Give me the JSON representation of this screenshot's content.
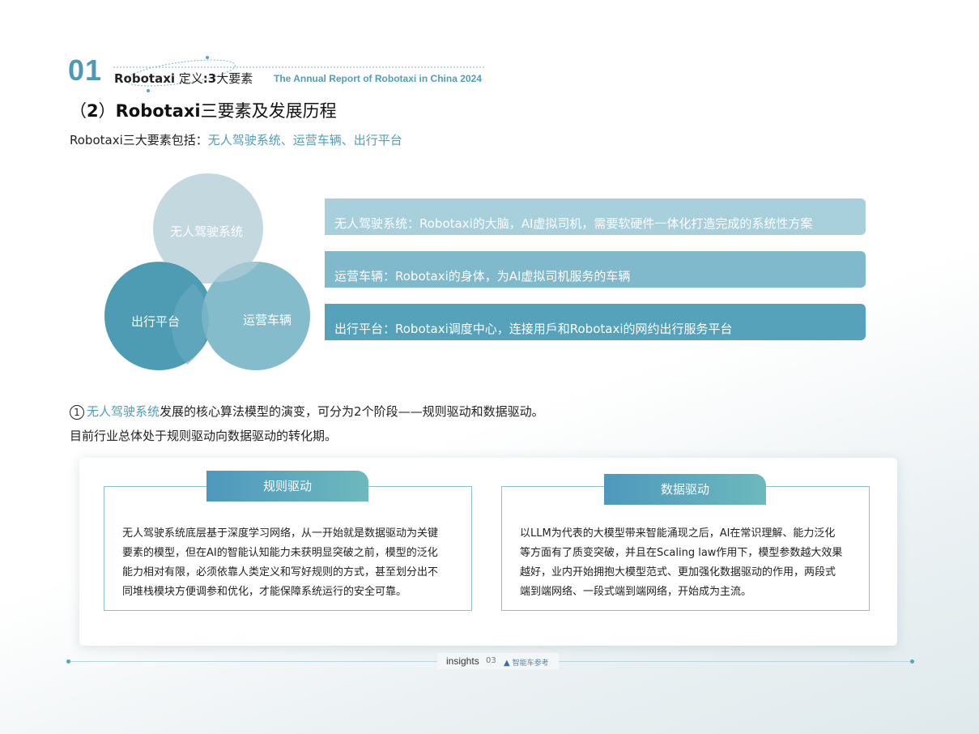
{
  "header": {
    "section_number": "01",
    "title_bold": "Robotaxi",
    "title_mid": " 定义",
    "title_bold2": ":3",
    "title_end": "大要素",
    "subtitle_en": "The Annual Report of Robotaxi in China 2024"
  },
  "section": {
    "heading_prefix": "（",
    "heading_num": "2",
    "heading_mid": "）",
    "heading_bold": "Robotaxi",
    "heading_rest": "三要素及发展历程"
  },
  "intro": {
    "prefix": "Robotaxi三大要素包括：",
    "highlight": "无人驾驶系统、运营车辆、出行平台"
  },
  "venn": {
    "top_label": "无人驾驶系统",
    "left_label": "出行平台",
    "right_label": "运营车辆",
    "colors": {
      "top": "#c4d8e0",
      "left": "#4e9bb4",
      "right": "#85bccc"
    }
  },
  "bars": [
    {
      "text": "无人驾驶系统：Robotaxi的大脑，AI虚拟司机，需要软硬件一体化打造完成的系统性方案"
    },
    {
      "text": "运营车辆：Robotaxi的身体，为AI虚拟司机服务的车辆"
    },
    {
      "text": "出行平台：Robotaxi调度中心，连接用戶和Robotaxi的网约出行服务平台"
    }
  ],
  "paragraph1": {
    "marker": "1",
    "highlight": "无人驾驶系统",
    "rest_bold": "发展的核心算",
    "rest": "法模型的演变，可分为2个阶段——规则驱动和数据驱动。"
  },
  "paragraph2": "目前行业总体处于规则驱动向数据驱动的转化期。",
  "stages": {
    "rule": {
      "title": "规则驱动",
      "lines": [
        "无人驾驶系统底层基于深度学习网络，从一开始就是数据驱动为关键",
        "要素的模型，但在AI的智能认知能力未获明显突破之前，模型的泛化",
        "能力相对有限，必须依靠人类定义和写好规则的方式，甚至划分出不",
        "同堆栈模块方便调参和优化，才能保障系统运行的安全可靠。"
      ]
    },
    "data": {
      "title": "数据驱动",
      "lines": [
        "以LLM为代表的大模型带来智能涌现之后，AI在常识理解、能力泛化",
        "等方面有了质变突破，并且在Scaling law作用下，模型参数越大效果",
        "越好，业内开始拥抱大模型范式、更加强化数据驱动的作用，两段式",
        "端到端网络、一段式端到端网络，开始成为主流。"
      ]
    }
  },
  "footer": {
    "brand": "insights",
    "page": "03",
    "logo_text": "智能车参考"
  }
}
